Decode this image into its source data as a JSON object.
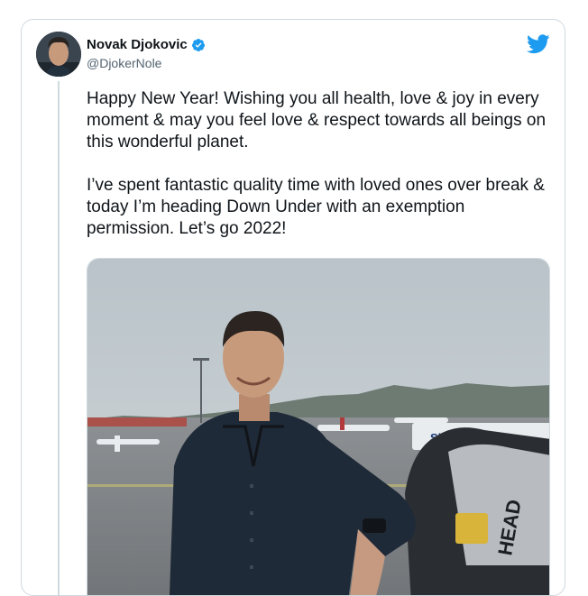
{
  "tweet": {
    "author": {
      "name": "Novak Djokovic",
      "handle": "@DjokerNole",
      "verified": true
    },
    "paragraphs": [
      "Happy New Year! Wishing you all health, love & joy in every moment & may you feel love & respect towards all beings on this wonderful planet.",
      "I’ve spent fantastic quality time with loved ones over break & today I’m heading Down Under with an exemption permission. Let’s go 2022!"
    ],
    "media": {
      "kind": "photo",
      "bag_brand": "HEAD",
      "sign_text": "Sk"
    }
  },
  "icons": {
    "verified": "verified-badge-icon",
    "platform": "bird-icon"
  },
  "colors": {
    "brand": "#1d9bf0",
    "text": "#0f1419",
    "muted": "#536471",
    "border": "#cfd9de"
  }
}
